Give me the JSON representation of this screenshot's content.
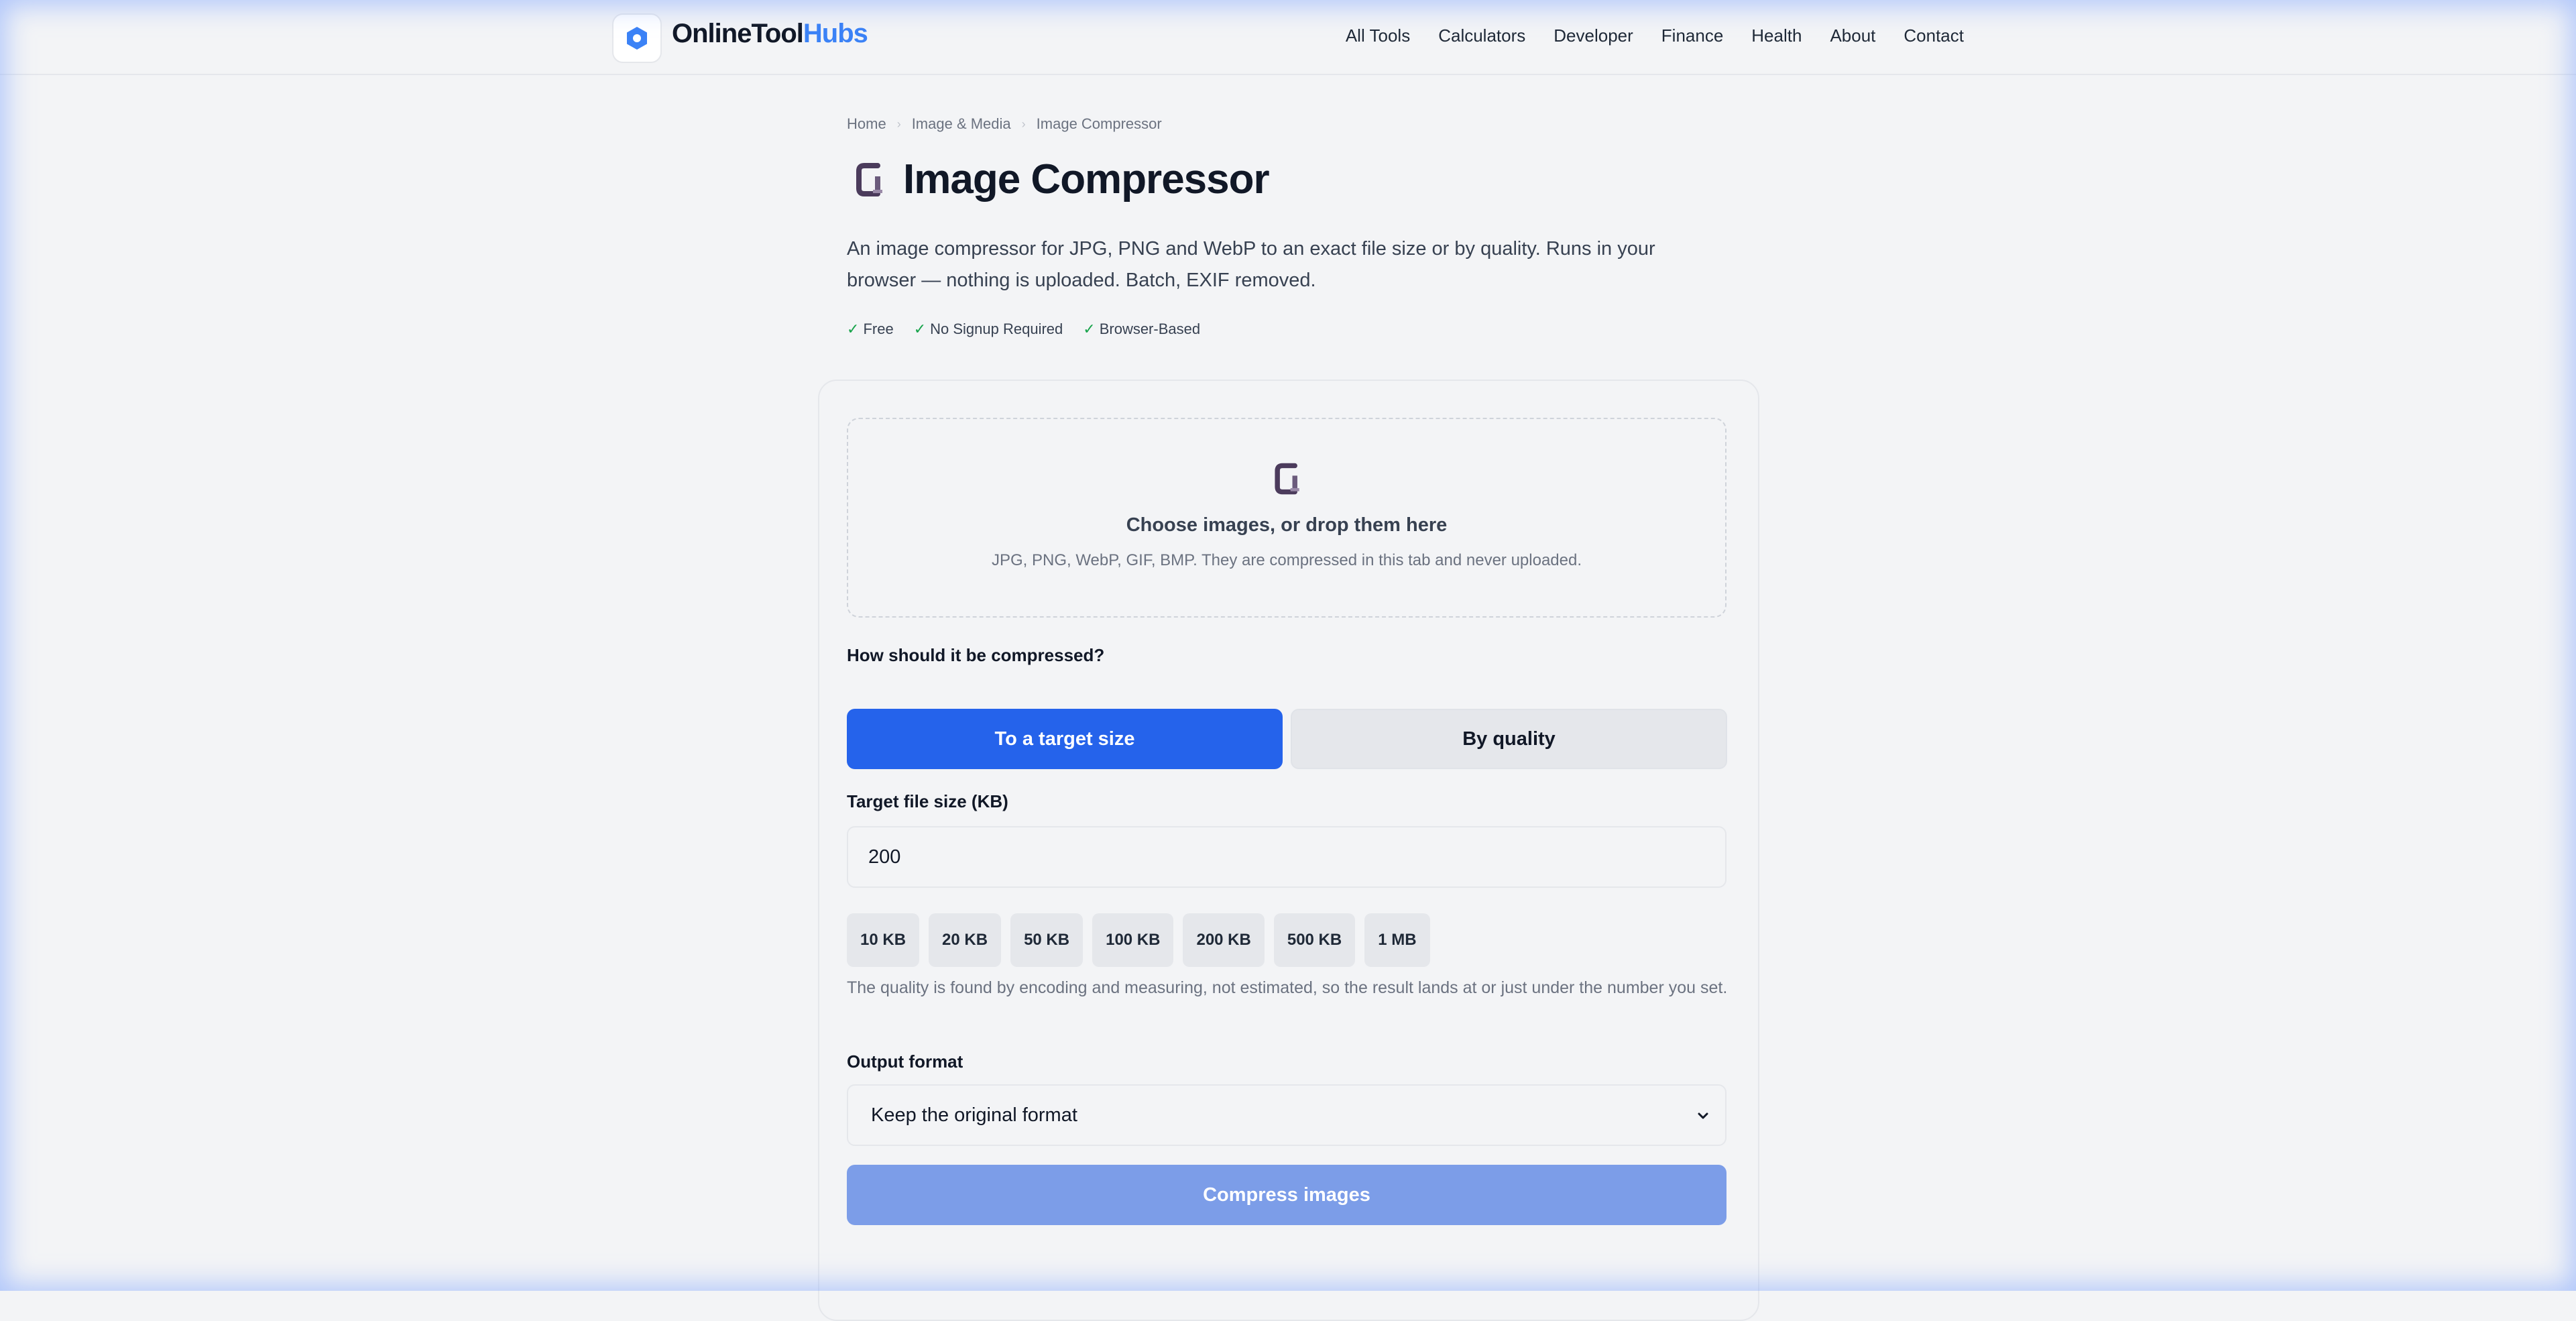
{
  "header": {
    "logo_main": "OnlineTool",
    "logo_accent": "Hubs",
    "nav": [
      "All Tools",
      "Calculators",
      "Developer",
      "Finance",
      "Health",
      "About",
      "Contact"
    ]
  },
  "breadcrumb": [
    "Home",
    "Image & Media",
    "Image Compressor"
  ],
  "page": {
    "title": "Image Compressor",
    "description": "An image compressor for JPG, PNG and WebP to an exact file size or by quality. Runs in your browser — nothing is uploaded. Batch, EXIF removed.",
    "badges": [
      "Free",
      "No Signup Required",
      "Browser-Based"
    ]
  },
  "dropzone": {
    "title": "Choose images, or drop them here",
    "subtitle": "JPG, PNG, WebP, GIF, BMP. They are compressed in this tab and never uploaded."
  },
  "compression": {
    "question": "How should it be compressed?",
    "mode_target": "To a target size",
    "mode_quality": "By quality",
    "target_label": "Target file size (KB)",
    "target_value": "200",
    "presets": [
      "10 KB",
      "20 KB",
      "50 KB",
      "100 KB",
      "200 KB",
      "500 KB",
      "1 MB"
    ],
    "hint": "The quality is found by encoding and measuring, not estimated, so the result lands at or just under the number you set.",
    "format_label": "Output format",
    "format_value": "Keep the original format",
    "submit": "Compress images"
  },
  "colors": {
    "primary": "#2563eb",
    "primary_disabled": "#7c9de8",
    "logo_accent": "#3b82f6",
    "check": "#16a34a"
  }
}
